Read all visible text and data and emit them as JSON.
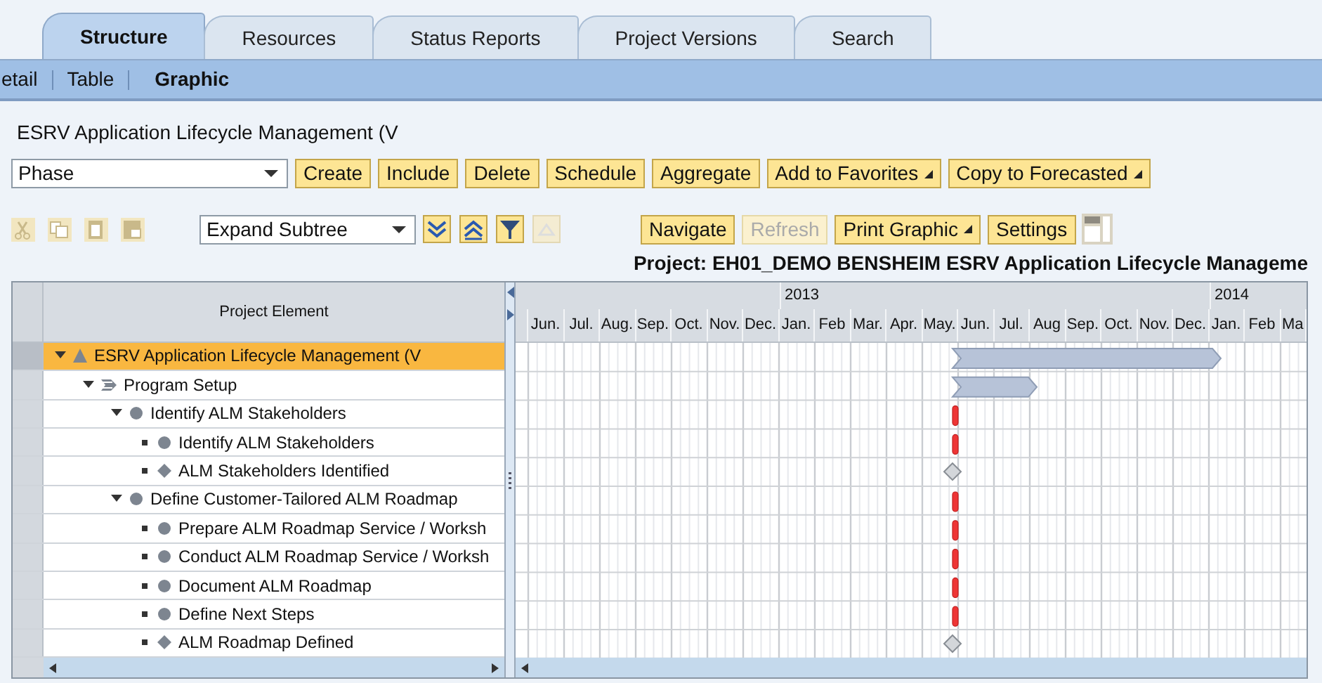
{
  "tabs": [
    {
      "label": "Structure",
      "selected": true
    },
    {
      "label": "Resources",
      "selected": false
    },
    {
      "label": "Status Reports",
      "selected": false
    },
    {
      "label": "Project Versions",
      "selected": false
    },
    {
      "label": "Search",
      "selected": false
    }
  ],
  "subtabs": [
    {
      "label": "etail",
      "selected": false
    },
    {
      "label": "Table",
      "selected": false
    },
    {
      "label": "Graphic",
      "selected": true
    }
  ],
  "object_title": "ESRV Application Lifecycle Management (V",
  "toolbar1": {
    "element_type": "Phase",
    "buttons": [
      {
        "label": "Create",
        "menu": false
      },
      {
        "label": "Include",
        "menu": false
      },
      {
        "label": "Delete",
        "menu": false
      },
      {
        "label": "Schedule",
        "menu": false
      },
      {
        "label": "Aggregate",
        "menu": false
      },
      {
        "label": "Add to Favorites",
        "menu": true
      },
      {
        "label": "Copy to Forecasted",
        "menu": true
      }
    ]
  },
  "toolbar2": {
    "clipboard_icons": [
      {
        "kind": "cut",
        "disabled": true
      },
      {
        "kind": "copy",
        "disabled": true
      },
      {
        "kind": "paste",
        "disabled": true
      },
      {
        "kind": "paste_special",
        "disabled": true
      }
    ],
    "expand_option": "Expand Subtree",
    "tree_buttons": [
      {
        "kind": "expand",
        "disabled": false
      },
      {
        "kind": "collapse",
        "disabled": false
      },
      {
        "kind": "filter",
        "disabled": false
      },
      {
        "kind": "reset",
        "disabled": true
      }
    ],
    "buttons": [
      {
        "label": "Navigate",
        "disabled": false,
        "menu": false
      },
      {
        "label": "Refresh",
        "disabled": true,
        "menu": false
      },
      {
        "label": "Print Graphic",
        "disabled": false,
        "menu": true
      },
      {
        "label": "Settings",
        "disabled": false,
        "menu": false
      }
    ]
  },
  "chart_title": "Project: EH01_DEMO BENSHEIM ESRV Application Lifecycle Manageme",
  "tree": {
    "column": "Project Element",
    "rows": [
      {
        "label": "ESRV Application Lifecycle Management (V",
        "kind": "project",
        "expanded": true,
        "selected": true,
        "children": [
          {
            "label": "Program Setup",
            "kind": "phase",
            "expanded": true,
            "selected": false,
            "children": [
              {
                "label": "Identify ALM Stakeholders",
                "kind": "task",
                "expanded": true,
                "selected": false,
                "children": [
                  {
                    "label": "Identify ALM Stakeholders",
                    "kind": "task",
                    "selected": false
                  },
                  {
                    "label": "ALM Stakeholders Identified",
                    "kind": "milestone",
                    "selected": false
                  }
                ]
              },
              {
                "label": "Define Customer-Tailored ALM Roadmap",
                "kind": "task",
                "expanded": true,
                "selected": false,
                "children": [
                  {
                    "label": "Prepare ALM Roadmap Service / Worksh",
                    "kind": "task",
                    "selected": false
                  },
                  {
                    "label": "Conduct ALM Roadmap Service / Worksh",
                    "kind": "task",
                    "selected": false
                  },
                  {
                    "label": "Document ALM Roadmap",
                    "kind": "task",
                    "selected": false
                  },
                  {
                    "label": "Define Next Steps",
                    "kind": "task",
                    "selected": false
                  },
                  {
                    "label": "ALM Roadmap Defined",
                    "kind": "milestone",
                    "selected": false
                  }
                ]
              }
            ]
          }
        ]
      }
    ]
  },
  "gantt": {
    "years": [
      "2013",
      "2014"
    ],
    "months": [
      "Jun.",
      "Jul.",
      "Aug.",
      "Sep.",
      "Oct.",
      "Nov.",
      "Dec.",
      "Jan.",
      "Feb",
      "Mar.",
      "Apr.",
      "May.",
      "Jun.",
      "Jul.",
      "Aug",
      "Sep.",
      "Oct.",
      "Nov.",
      "Dec.",
      "Jan.",
      "Feb",
      "Ma"
    ]
  }
}
